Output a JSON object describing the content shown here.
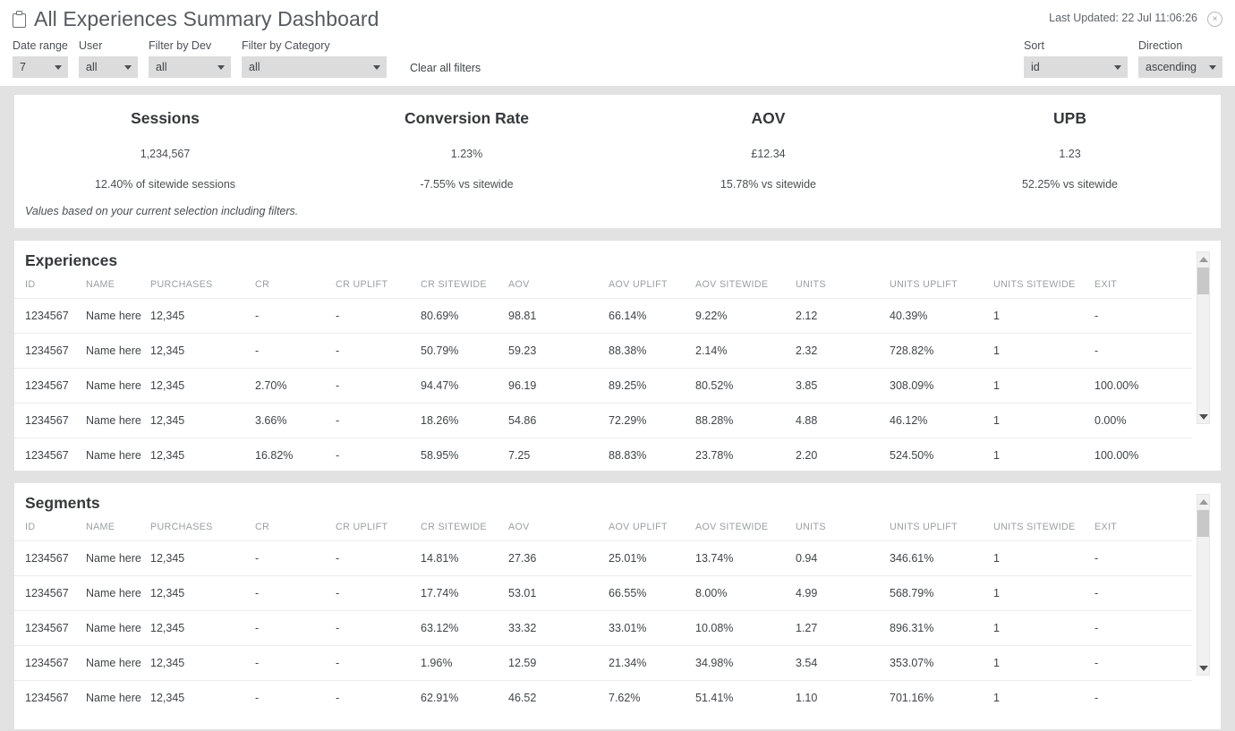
{
  "header": {
    "title": "All Experiences Summary Dashboard",
    "clipboard_icon": "clipboard-icon",
    "last_updated": "Last Updated: 22 Jul 11:06:26",
    "close_icon": "×"
  },
  "filters": {
    "date_range": {
      "label": "Date range",
      "value": "7"
    },
    "user": {
      "label": "User",
      "value": "all"
    },
    "dev": {
      "label": "Filter by Dev",
      "value": "all"
    },
    "category": {
      "label": "Filter by Category",
      "value": "all"
    },
    "clear_all": "Clear all filters",
    "sort": {
      "label": "Sort",
      "value": "id"
    },
    "direction": {
      "label": "Direction",
      "value": "ascending"
    }
  },
  "kpis": [
    {
      "title": "Sessions",
      "value": "1,234,567",
      "sub": "12.40% of sitewide sessions"
    },
    {
      "title": "Conversion Rate",
      "value": "1.23%",
      "sub": "-7.55% vs sitewide"
    },
    {
      "title": "AOV",
      "value": "£12.34",
      "sub": "15.78% vs sitewide"
    },
    {
      "title": "UPB",
      "value": "1.23",
      "sub": "52.25% vs sitewide"
    }
  ],
  "kpi_note": "Values based on your current selection including filters.",
  "columns": [
    "ID",
    "NAME",
    "PURCHASES",
    "CR",
    "CR UPLIFT",
    "CR SITEWIDE",
    "AOV",
    "AOV UPLIFT",
    "AOV SITEWIDE",
    "UNITS",
    "UNITS UPLIFT",
    "UNITS SITEWIDE",
    "EXIT"
  ],
  "experiences": {
    "title": "Experiences",
    "rows": [
      [
        "1234567",
        "Name here",
        "12,345",
        "-",
        "-",
        "80.69%",
        "98.81",
        "66.14%",
        "9.22%",
        "2.12",
        "40.39%",
        "1",
        "-"
      ],
      [
        "1234567",
        "Name here",
        "12,345",
        "-",
        "-",
        "50.79%",
        "59.23",
        "88.38%",
        "2.14%",
        "2.32",
        "728.82%",
        "1",
        "-"
      ],
      [
        "1234567",
        "Name here",
        "12,345",
        "2.70%",
        "-",
        "94.47%",
        "96.19",
        "89.25%",
        "80.52%",
        "3.85",
        "308.09%",
        "1",
        "100.00%"
      ],
      [
        "1234567",
        "Name here",
        "12,345",
        "3.66%",
        "-",
        "18.26%",
        "54.86",
        "72.29%",
        "88.28%",
        "4.88",
        "46.12%",
        "1",
        "0.00%"
      ],
      [
        "1234567",
        "Name here",
        "12,345",
        "16.82%",
        "-",
        "58.95%",
        "7.25",
        "88.83%",
        "23.78%",
        "2.20",
        "524.50%",
        "1",
        "100.00%"
      ]
    ]
  },
  "segments": {
    "title": "Segments",
    "rows": [
      [
        "1234567",
        "Name here",
        "12,345",
        "-",
        "-",
        "14.81%",
        "27.36",
        "25.01%",
        "13.74%",
        "0.94",
        "346.61%",
        "1",
        "-"
      ],
      [
        "1234567",
        "Name here",
        "12,345",
        "-",
        "-",
        "17.74%",
        "53.01",
        "66.55%",
        "8.00%",
        "4.99",
        "568.79%",
        "1",
        "-"
      ],
      [
        "1234567",
        "Name here",
        "12,345",
        "-",
        "-",
        "63.12%",
        "33.32",
        "33.01%",
        "10.08%",
        "1.27",
        "896.31%",
        "1",
        "-"
      ],
      [
        "1234567",
        "Name here",
        "12,345",
        "-",
        "-",
        "1.96%",
        "12.59",
        "21.34%",
        "34.98%",
        "3.54",
        "353.07%",
        "1",
        "-"
      ],
      [
        "1234567",
        "Name here",
        "12,345",
        "-",
        "-",
        "62.91%",
        "46.52",
        "7.62%",
        "51.41%",
        "1.10",
        "701.16%",
        "1",
        "-"
      ]
    ]
  },
  "colors": {
    "page_bg": "#e2e2e2",
    "card_bg": "#ffffff",
    "text": "#3f4447",
    "muted": "#9a9fa3"
  }
}
